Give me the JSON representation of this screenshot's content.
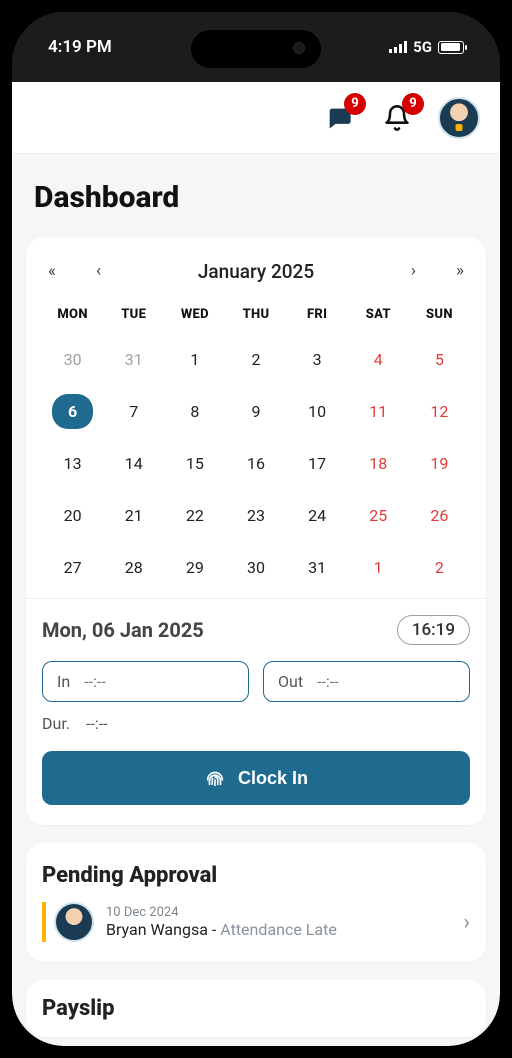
{
  "status": {
    "time": "4:19 PM",
    "network": "5G"
  },
  "header": {
    "chat_badge": "9",
    "notif_badge": "9"
  },
  "page_title": "Dashboard",
  "calendar": {
    "month_label": "January 2025",
    "dow": [
      "MON",
      "TUE",
      "WED",
      "THU",
      "FRI",
      "SAT",
      "SUN"
    ],
    "weeks": [
      [
        {
          "n": "30",
          "other": true
        },
        {
          "n": "31",
          "other": true
        },
        {
          "n": "1"
        },
        {
          "n": "2"
        },
        {
          "n": "3"
        },
        {
          "n": "4",
          "weekend": true
        },
        {
          "n": "5",
          "weekend": true
        }
      ],
      [
        {
          "n": "6",
          "selected": true
        },
        {
          "n": "7"
        },
        {
          "n": "8"
        },
        {
          "n": "9"
        },
        {
          "n": "10"
        },
        {
          "n": "11",
          "weekend": true
        },
        {
          "n": "12",
          "weekend": true
        }
      ],
      [
        {
          "n": "13"
        },
        {
          "n": "14"
        },
        {
          "n": "15"
        },
        {
          "n": "16"
        },
        {
          "n": "17"
        },
        {
          "n": "18",
          "weekend": true
        },
        {
          "n": "19",
          "weekend": true
        }
      ],
      [
        {
          "n": "20"
        },
        {
          "n": "21"
        },
        {
          "n": "22"
        },
        {
          "n": "23"
        },
        {
          "n": "24"
        },
        {
          "n": "25",
          "weekend": true
        },
        {
          "n": "26",
          "weekend": true
        }
      ],
      [
        {
          "n": "27"
        },
        {
          "n": "28"
        },
        {
          "n": "29"
        },
        {
          "n": "30"
        },
        {
          "n": "31"
        },
        {
          "n": "1",
          "weekend": true,
          "other": false
        },
        {
          "n": "2",
          "weekend": true,
          "other": false
        }
      ]
    ]
  },
  "attendance": {
    "date_label": "Mon, 06 Jan 2025",
    "now": "16:19",
    "in_label": "In",
    "in_value": "--:--",
    "out_label": "Out",
    "out_value": "--:--",
    "dur_label": "Dur.",
    "dur_value": "--:--",
    "clockin_label": "Clock In"
  },
  "pending": {
    "title": "Pending Approval",
    "item": {
      "date": "10 Dec 2024",
      "name": "Bryan Wangsa",
      "sep": " - ",
      "reason": "Attendance Late"
    }
  },
  "payslip": {
    "title": "Payslip"
  }
}
